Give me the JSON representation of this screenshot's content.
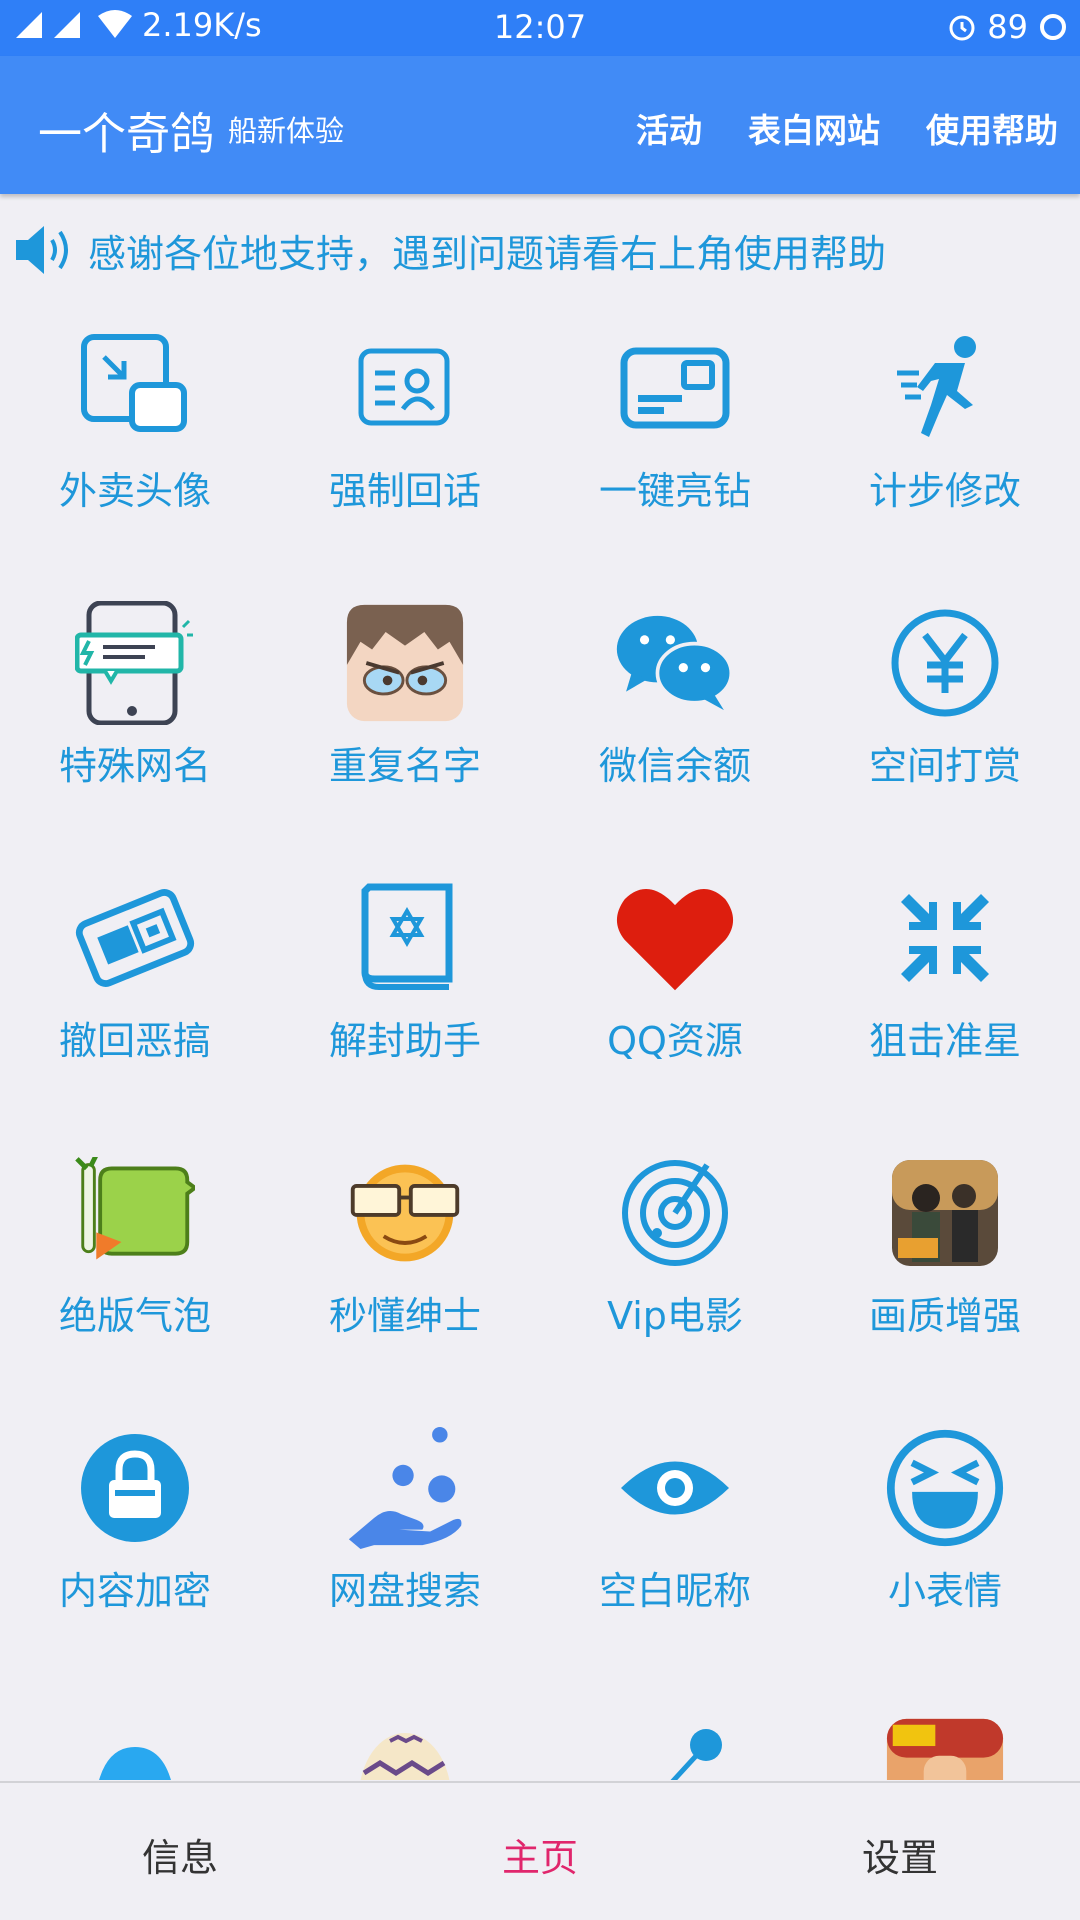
{
  "status": {
    "net_speed": "2.19K/s",
    "time": "12:07",
    "battery": "89"
  },
  "header": {
    "title": "一个奇鸽",
    "subtitle": "船新体验",
    "actions": [
      "活动",
      "表白网站",
      "使用帮助"
    ]
  },
  "notice": {
    "text": "感谢各位地支持，遇到问题请看右上角使用帮助"
  },
  "grid": {
    "items": [
      {
        "label": "外卖头像",
        "icon": "avatar-resize-icon"
      },
      {
        "label": "强制回话",
        "icon": "contact-card-icon"
      },
      {
        "label": "一键亮钻",
        "icon": "card-icon"
      },
      {
        "label": "计步修改",
        "icon": "running-man-icon"
      },
      {
        "label": "特殊网名",
        "icon": "tablet-message-icon"
      },
      {
        "label": "重复名字",
        "icon": "cartoon-face-icon"
      },
      {
        "label": "微信余额",
        "icon": "wechat-icon"
      },
      {
        "label": "空间打赏",
        "icon": "yen-coin-icon"
      },
      {
        "label": "撤回恶搞",
        "icon": "recall-stamp-icon"
      },
      {
        "label": "解封助手",
        "icon": "star-book-icon"
      },
      {
        "label": "QQ资源",
        "icon": "heart-icon"
      },
      {
        "label": "狙击准星",
        "icon": "compress-arrows-icon"
      },
      {
        "label": "绝版气泡",
        "icon": "vegetable-bubble-icon"
      },
      {
        "label": "秒懂绅士",
        "icon": "glasses-emoji-icon"
      },
      {
        "label": "Vip电影",
        "icon": "radar-icon"
      },
      {
        "label": "画质增强",
        "icon": "pubg-game-icon"
      },
      {
        "label": "内容加密",
        "icon": "lock-icon"
      },
      {
        "label": "网盘搜索",
        "icon": "hand-bubbles-icon"
      },
      {
        "label": "空白昵称",
        "icon": "eye-icon"
      },
      {
        "label": "小表情",
        "icon": "laughing-face-icon"
      },
      {
        "label": "",
        "icon": "blue-ghost-icon"
      },
      {
        "label": "",
        "icon": "easter-egg-icon"
      },
      {
        "label": "",
        "icon": "pushpin-icon"
      },
      {
        "label": "",
        "icon": "kings-glory-game-icon"
      }
    ]
  },
  "bottom_nav": {
    "tabs": [
      "信息",
      "主页",
      "设置"
    ],
    "active": "主页"
  },
  "colors": {
    "statusbar": "#2f7ff7",
    "appbar": "#418bf6",
    "accent": "#1e97da",
    "active_tab": "#e0266c",
    "background": "#f0eff4"
  }
}
